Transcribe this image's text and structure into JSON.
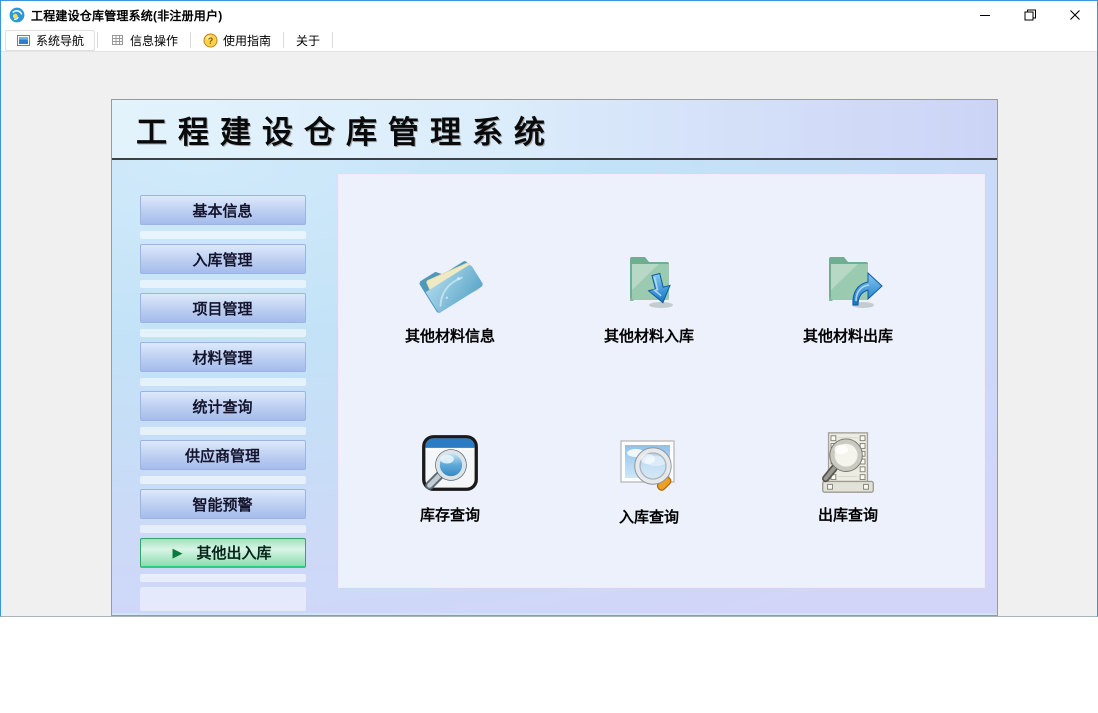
{
  "window": {
    "title": "工程建设仓库管理系统(非注册用户)"
  },
  "menubar": {
    "items": [
      {
        "label": "系统导航",
        "icon": "nav-square-icon",
        "selected": true
      },
      {
        "label": "信息操作",
        "icon": "grid-icon",
        "selected": false
      },
      {
        "label": "使用指南",
        "icon": "help-icon",
        "selected": false
      },
      {
        "label": "关于",
        "icon": "",
        "selected": false
      }
    ],
    "help_glyph": "?"
  },
  "banner": {
    "title": "工程建设仓库管理系统"
  },
  "sidebar": {
    "active_arrow": "▶",
    "items": [
      {
        "label": "基本信息",
        "active": false
      },
      {
        "label": "入库管理",
        "active": false
      },
      {
        "label": "项目管理",
        "active": false
      },
      {
        "label": "材料管理",
        "active": false
      },
      {
        "label": "统计查询",
        "active": false
      },
      {
        "label": "供应商管理",
        "active": false
      },
      {
        "label": "智能预警",
        "active": false
      },
      {
        "label": "其他出入库",
        "active": true
      }
    ]
  },
  "shortcuts": [
    {
      "label": "其他材料信息",
      "icon": "folder-open-icon"
    },
    {
      "label": "其他材料入库",
      "icon": "folder-arrow-down-icon"
    },
    {
      "label": "其他材料出库",
      "icon": "folder-arrow-up-icon"
    },
    {
      "label": "库存查询",
      "icon": "window-magnifier-icon"
    },
    {
      "label": "入库查询",
      "icon": "photo-magnifier-icon"
    },
    {
      "label": "出库查询",
      "icon": "film-magnifier-icon"
    }
  ],
  "colors": {
    "accent_blue": "#2f99e0",
    "banner_from": "#e3f3fc",
    "banner_to": "#ccd4f6",
    "button_from": "#dde9fb",
    "button_to": "#a4bcec",
    "active_from": "#d9f4e6",
    "active_to": "#8ddcb0",
    "inner_panel_bg": "#edf1fc"
  }
}
